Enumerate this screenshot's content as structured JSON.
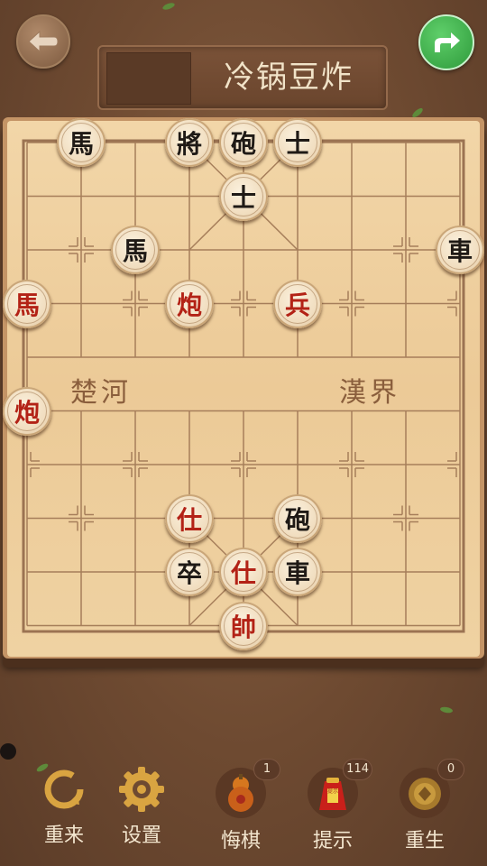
{
  "header": {
    "title": "冷锅豆炸"
  },
  "board": {
    "river_left": "楚河",
    "river_right": "漢界"
  },
  "pieces": [
    {
      "char": "馬",
      "color": "black",
      "col": 1,
      "row": 0
    },
    {
      "char": "將",
      "color": "black",
      "col": 3,
      "row": 0
    },
    {
      "char": "砲",
      "color": "black",
      "col": 4,
      "row": 0
    },
    {
      "char": "士",
      "color": "black",
      "col": 5,
      "row": 0
    },
    {
      "char": "士",
      "color": "black",
      "col": 4,
      "row": 1
    },
    {
      "char": "馬",
      "color": "black",
      "col": 2,
      "row": 2
    },
    {
      "char": "車",
      "color": "black",
      "col": 8,
      "row": 2
    },
    {
      "char": "馬",
      "color": "red",
      "col": 0,
      "row": 3
    },
    {
      "char": "炮",
      "color": "red",
      "col": 3,
      "row": 3
    },
    {
      "char": "兵",
      "color": "red",
      "col": 5,
      "row": 3
    },
    {
      "char": "炮",
      "color": "red",
      "col": 0,
      "row": 5
    },
    {
      "char": "仕",
      "color": "red",
      "col": 3,
      "row": 7
    },
    {
      "char": "砲",
      "color": "black",
      "col": 5,
      "row": 7
    },
    {
      "char": "卒",
      "color": "black",
      "col": 3,
      "row": 8
    },
    {
      "char": "仕",
      "color": "red",
      "col": 4,
      "row": 8
    },
    {
      "char": "車",
      "color": "black",
      "col": 5,
      "row": 8
    },
    {
      "char": "帥",
      "color": "red",
      "col": 4,
      "row": 9
    }
  ],
  "toolbar": {
    "restart_label": "重来",
    "settings_label": "设置",
    "undo_label": "悔棋",
    "undo_count": "1",
    "hint_label": "提示",
    "hint_count": "114",
    "hint_tag": "提示",
    "revive_label": "重生",
    "revive_count": "0"
  }
}
